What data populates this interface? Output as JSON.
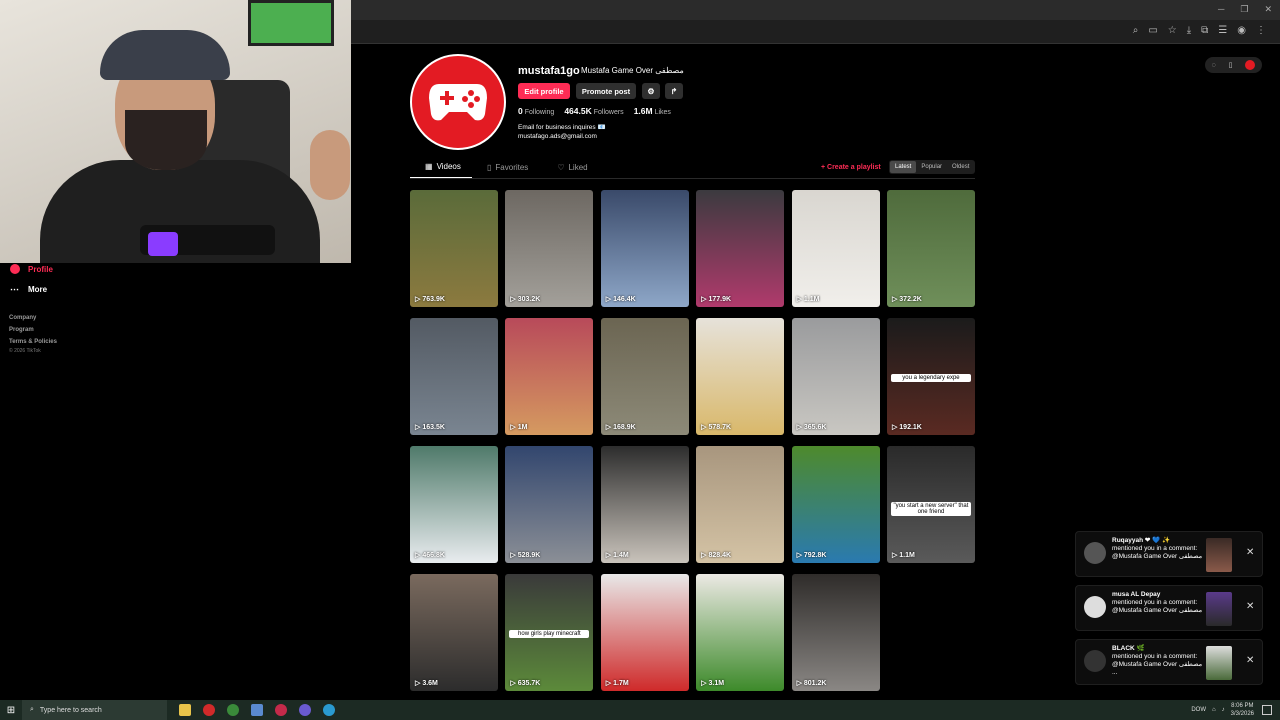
{
  "profile": {
    "username": "mustafa1go",
    "display_name": "Mustafa Game Over مصطفى",
    "edit_label": "Edit profile",
    "promote_label": "Promote post",
    "following_count": "0",
    "following_label": "Following",
    "followers_count": "464.5K",
    "followers_label": "Followers",
    "likes_count": "1.6M",
    "likes_label": "Likes",
    "bio_line1": "Email for business inquires 📧",
    "bio_line2": "mustafago.ads@gmail.com"
  },
  "tabs": [
    {
      "label": "Videos",
      "icon": "grid-icon"
    },
    {
      "label": "Favorites",
      "icon": "bookmark-icon"
    },
    {
      "label": "Liked",
      "icon": "heart-icon"
    }
  ],
  "create_playlist": "+ Create a playlist",
  "sort": [
    "Latest",
    "Popular",
    "Oldest"
  ],
  "sidebar": {
    "profile_label": "Profile",
    "more_label": "More",
    "links": [
      "Company",
      "Program",
      "Terms & Policies"
    ],
    "copyright": "© 2026 TikTok"
  },
  "videos": [
    {
      "views": "763.9K",
      "c1": "#5a6b3a",
      "c2": "#8c7a3f"
    },
    {
      "views": "303.2K",
      "c1": "#6d6862",
      "c2": "#a3a09a"
    },
    {
      "views": "146.4K",
      "c1": "#3a4a6a",
      "c2": "#8ea7c8"
    },
    {
      "views": "177.9K",
      "c1": "#3b3a3f",
      "c2": "#b03a6c"
    },
    {
      "views": "1.1M",
      "c1": "#d9d6d0",
      "c2": "#f1efeb"
    },
    {
      "views": "372.2K",
      "c1": "#4f6b3c",
      "c2": "#6f8f5a"
    },
    {
      "views": "163.5K",
      "c1": "#535a63",
      "c2": "#7a8591"
    },
    {
      "views": "1M",
      "c1": "#b84a5a",
      "c2": "#d59a60"
    },
    {
      "views": "168.9K",
      "c1": "#6b6552",
      "c2": "#8d8a78"
    },
    {
      "views": "578.7K",
      "c1": "#e6e2da",
      "c2": "#d9b86a"
    },
    {
      "views": "365.6K",
      "c1": "#9a9b9d",
      "c2": "#c9c7c2"
    },
    {
      "views": "192.1K",
      "c1": "#1b1b1b",
      "c2": "#5a2a22"
    },
    {
      "views": "466.8K",
      "c1": "#4f7a6a",
      "c2": "#e9ecef"
    },
    {
      "views": "528.9K",
      "c1": "#32466e",
      "c2": "#8b8f96"
    },
    {
      "views": "1.4M",
      "c1": "#2d2d2d",
      "c2": "#c9c3bb"
    },
    {
      "views": "828.4K",
      "c1": "#a8967e",
      "c2": "#d4c3a5"
    },
    {
      "views": "792.8K",
      "c1": "#4e8a2c",
      "c2": "#2a7ab0"
    },
    {
      "views": "1.1M",
      "c1": "#2a2a2a",
      "c2": "#5a5a5a"
    },
    {
      "views": "3.6M",
      "c1": "#7a6a5e",
      "c2": "#2c2c2c"
    },
    {
      "views": "635.7K",
      "c1": "#3a3a3a",
      "c2": "#5c8a3a"
    },
    {
      "views": "1.7M",
      "c1": "#e8e8e8",
      "c2": "#cf2a2a"
    },
    {
      "views": "3.1M",
      "c1": "#ece9e4",
      "c2": "#3d8a2a"
    },
    {
      "views": "801.2K",
      "c1": "#2f2c2a",
      "c2": "#8a8784"
    }
  ],
  "video_captions": {
    "v12": "you a legendary expe",
    "v18": "\"you start a new server\" that one friend",
    "v20": "how girls play minecraft"
  },
  "notifications": [
    {
      "name": "Ruqayyah ❤ 💙 ✨",
      "line": "mentioned you in a comment: @Mustafa Game Over مصطفى"
    },
    {
      "name": "musa AL Depay",
      "line": "mentioned you in a comment: @Mustafa Game Over مصطفى"
    },
    {
      "name": "BLACK 🌿",
      "line": "mentioned you in a comment: @Mustafa Game Over مصطفى ..."
    }
  ],
  "taskbar": {
    "search_placeholder": "Type here to search",
    "time": "8:06 PM",
    "date": "3/3/2026",
    "dow": "DOW"
  },
  "colors": {
    "accent": "#fe2c55",
    "brand_red": "#e31b23"
  }
}
